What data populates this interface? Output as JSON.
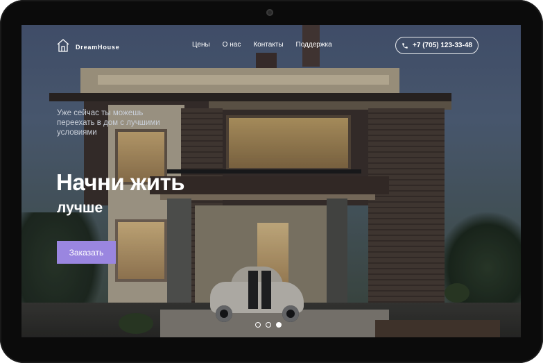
{
  "logo": {
    "text": "DreamHouse",
    "icon": "house-outline-icon"
  },
  "nav": {
    "items": [
      "Цены",
      "О нас",
      "Контакты",
      "Поддержка"
    ]
  },
  "phone": {
    "number": "+7 (705) 123-33-48",
    "icon": "phone-icon"
  },
  "hero": {
    "subtitle": "Уже сейчас ты можешь переехать в дом с лучшими условиями",
    "title": "Начни жить",
    "title_second": "лучше",
    "cta_label": "Заказать"
  },
  "slider": {
    "count": 3,
    "active_index": 2
  },
  "colors": {
    "accent": "#9a86e0",
    "text": "#ffffff"
  }
}
